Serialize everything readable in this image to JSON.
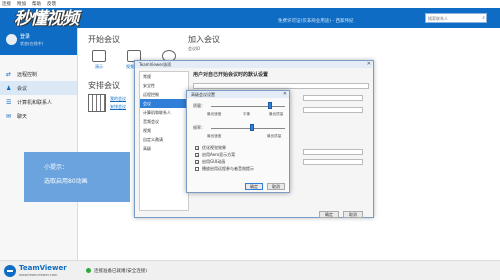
{
  "menu": [
    "连接",
    "附加",
    "帮助",
    "反馈"
  ],
  "header": {
    "license": "免费许可证(仅非商业用途) - 西家伟纪",
    "search_placeholder": "搜索联系人"
  },
  "watermark": "秒懂视频",
  "profile": {
    "name": "登录",
    "status": "状态(在线中)"
  },
  "nav": [
    {
      "label": "远程控制",
      "icon": "arrows-icon"
    },
    {
      "label": "会议",
      "icon": "meeting-icon"
    },
    {
      "label": "计算机和联系人",
      "icon": "contacts-icon"
    },
    {
      "label": "聊天",
      "icon": "chat-icon"
    }
  ],
  "main": {
    "start_title": "开始会议",
    "join_title": "加入会议",
    "meeting_id": "会议ID",
    "tiles": [
      "演示",
      "视频通话",
      "电话"
    ],
    "schedule_title": "安排会议",
    "links": [
      "我的会议",
      "安排会议"
    ]
  },
  "tip": {
    "line1": "小提示：",
    "line2": "选取启用80动画"
  },
  "options": {
    "title": "TeamViewer选项",
    "categories": [
      "常规",
      "安全性",
      "远程控制",
      "会议",
      "计算机和联系人",
      "音频会议",
      "视频",
      "自定义邀请",
      "高级"
    ],
    "selected_index": 3,
    "heading": "用户对自己开始会议时的默认设置",
    "ok": "确定",
    "cancel": "取消"
  },
  "advanced": {
    "title": "高级会议设置",
    "quality_label": "质量：",
    "quality_ticks": [
      "最优速度",
      "平衡",
      "最优质量"
    ],
    "quality_value": 0.8,
    "speed_label": "帧率：",
    "speed_ticks": [
      "最优速度",
      "最优质量"
    ],
    "speed_value": 0.55,
    "checkboxes": [
      {
        "label": "优化视觉效果",
        "checked": true
      },
      {
        "label": "启用Aero显示方案",
        "checked": true
      },
      {
        "label": "启用GUI动画",
        "checked": true
      },
      {
        "label": "播放启用远程参与者音效提示",
        "checked": false
      }
    ],
    "ok": "确定",
    "cancel": "取消"
  },
  "bottom": {
    "brand": "TeamViewer",
    "url": "www.teamviewer.com",
    "status": "连接准备已就绪(安全连接)"
  }
}
